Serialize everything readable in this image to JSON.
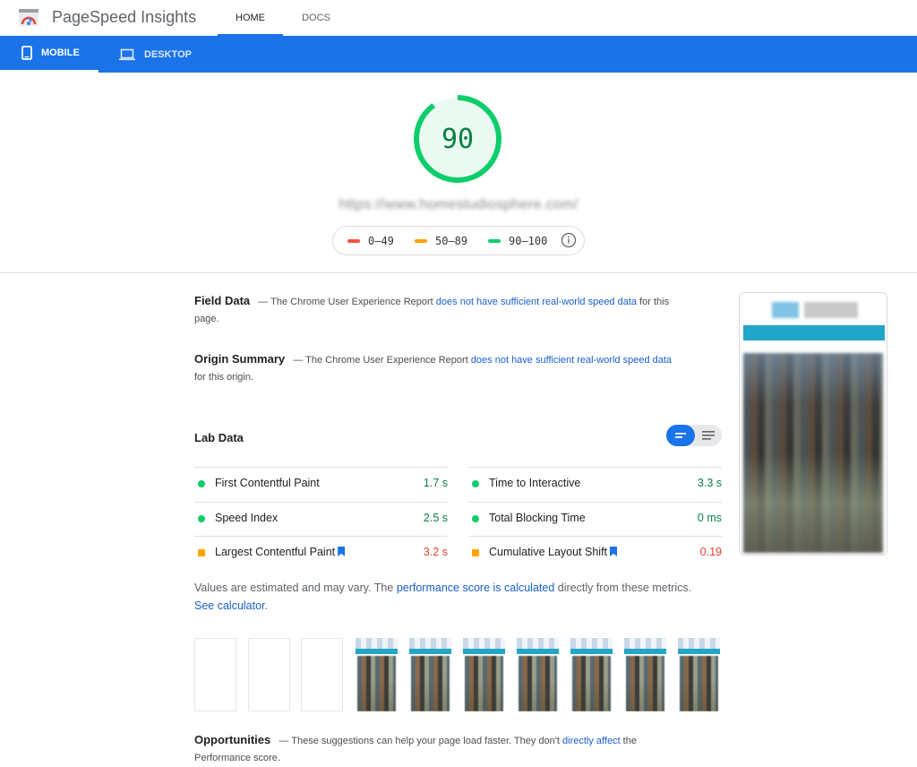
{
  "app": {
    "title": "PageSpeed Insights"
  },
  "nav": {
    "home": "HOME",
    "docs": "DOCS"
  },
  "devices": {
    "mobile": "MOBILE",
    "desktop": "DESKTOP"
  },
  "score": {
    "value": "90",
    "fraction": 0.9,
    "color": "#0cce6b"
  },
  "url": "https://www.homestudiosphere.com/",
  "legend": {
    "fail": "0–49",
    "average": "50–89",
    "pass": "90–100",
    "colors": {
      "fail": "#ff4e42",
      "average": "#ffa400",
      "pass": "#0cce6b"
    }
  },
  "field_data": {
    "title": "Field Data",
    "dash": "—",
    "text_before": "The Chrome User Experience Report ",
    "link": "does not have sufficient real-world speed data",
    "text_after": " for this page."
  },
  "origin_summary": {
    "title": "Origin Summary",
    "dash": "—",
    "text_before": "The Chrome User Experience Report ",
    "link": "does not have sufficient real-world speed data",
    "text_after": " for this origin."
  },
  "lab_data": {
    "title": "Lab Data",
    "metrics": [
      {
        "name": "First Contentful Paint",
        "value": "1.7 s",
        "status": "pass"
      },
      {
        "name": "Time to Interactive",
        "value": "3.3 s",
        "status": "pass"
      },
      {
        "name": "Speed Index",
        "value": "2.5 s",
        "status": "pass"
      },
      {
        "name": "Total Blocking Time",
        "value": "0 ms",
        "status": "pass"
      },
      {
        "name": "Largest Contentful Paint",
        "value": "3.2 s",
        "status": "average"
      },
      {
        "name": "Cumulative Layout Shift",
        "value": "0.19",
        "status": "average"
      }
    ]
  },
  "note": {
    "text_before": "Values are estimated and may vary. The ",
    "link1": "performance score is calculated",
    "text_mid": " directly from these metrics. ",
    "link2": "See calculator",
    "text_after": "."
  },
  "opportunities": {
    "title": "Opportunities",
    "dash": "—",
    "text_before": "These suggestions can help your page load faster. They don't ",
    "link": "directly affect",
    "text_after": " the Performance score."
  }
}
